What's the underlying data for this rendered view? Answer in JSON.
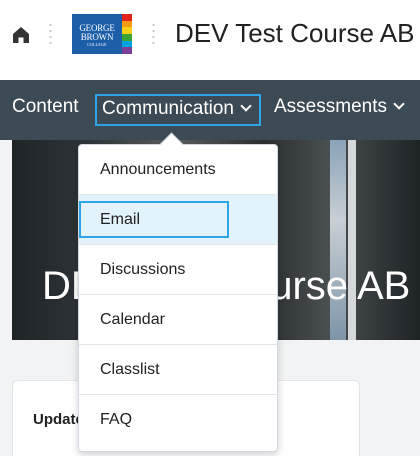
{
  "header": {
    "course_title": "DEV Test Course AB",
    "logo": {
      "line1": "GEORGE",
      "line2": "BROWN",
      "line3": "COLLEGE",
      "stripes": [
        "#e2231a",
        "#f39c12",
        "#f7d117",
        "#3aa335",
        "#00a3e0",
        "#7b3f98"
      ]
    }
  },
  "navbar": {
    "items": [
      {
        "label": "Content"
      },
      {
        "label": "Communication"
      },
      {
        "label": "Assessments"
      }
    ]
  },
  "banner": {
    "title": "DEV Test Course AB"
  },
  "dropdown": {
    "items": [
      {
        "label": "Announcements"
      },
      {
        "label": "Email"
      },
      {
        "label": "Discussions"
      },
      {
        "label": "Calendar"
      },
      {
        "label": "Classlist"
      },
      {
        "label": "FAQ"
      }
    ],
    "selected": "Email"
  },
  "card": {
    "title": "Updates"
  },
  "colors": {
    "navbar": "#3c4a55",
    "focus": "#2ca6e6",
    "selected_bg": "#e3f3fb",
    "logo_blue": "#1d5ea8"
  },
  "icons": {
    "home": "home-icon",
    "chevron": "chevron-down-icon"
  }
}
